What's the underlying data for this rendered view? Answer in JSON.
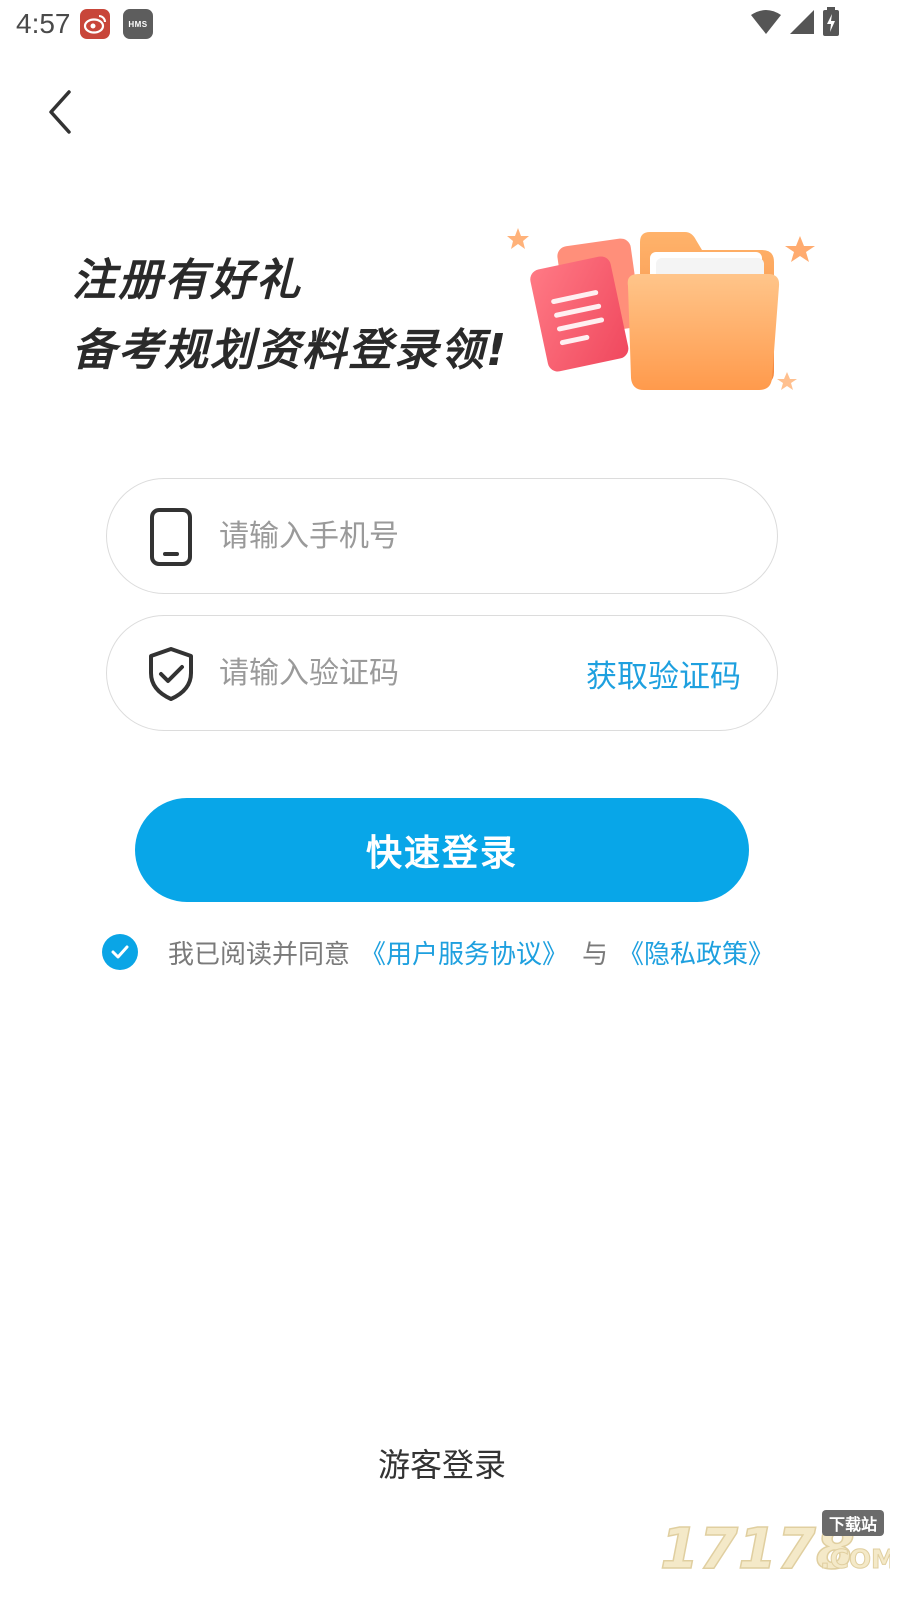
{
  "status_bar": {
    "time": "4:57",
    "hms_label": "HMS",
    "icons": [
      "weibo-app-icon",
      "hms-icon",
      "wifi-icon",
      "cell-signal-icon",
      "battery-charging-icon"
    ]
  },
  "banner": {
    "line1": "注册有好礼",
    "line2": "备考规划资料登录领!"
  },
  "phone_field": {
    "placeholder": "请输入手机号",
    "value": ""
  },
  "code_field": {
    "placeholder": "请输入验证码",
    "value": "",
    "get_code_label": "获取验证码"
  },
  "login_button_label": "快速登录",
  "agreement": {
    "checked": true,
    "prefix": "我已阅读并同意",
    "user_agreement": "《用户服务协议》",
    "and": "与",
    "privacy_policy": "《隐私政策》"
  },
  "guest_login_label": "游客登录",
  "watermark": {
    "number": "17178",
    "tag": "下载站",
    "suffix": ".COM"
  },
  "colors": {
    "accent": "#08a6e8",
    "link": "#1ea0df",
    "border": "#dcdcdc"
  }
}
